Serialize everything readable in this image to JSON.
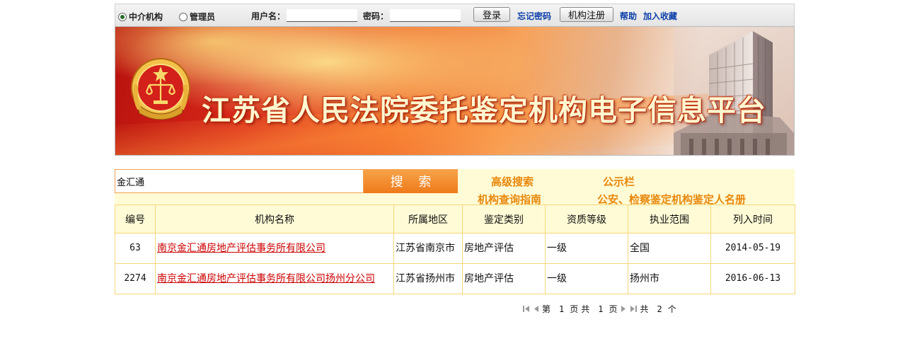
{
  "login": {
    "role_options": [
      {
        "label": "中介机构",
        "checked": true
      },
      {
        "label": "管理员",
        "checked": false
      }
    ],
    "username_label": "用户名：",
    "username_value": "",
    "password_label": "密码：",
    "password_value": "",
    "login_button": "登录",
    "forgot_link": "忘记密码",
    "register_button": "机构注册",
    "help_link": "帮助",
    "favorite_link": "加入收藏"
  },
  "banner": {
    "title": "江苏省人民法院委托鉴定机构电子信息平台",
    "emblem_icon": "court-emblem-icon",
    "building_icon": "court-building-icon"
  },
  "search": {
    "value": "金汇通",
    "button": "搜 索",
    "links": {
      "advanced": "高级搜索",
      "notice": "公示栏",
      "guide": "机构查询指南",
      "registry": "公安、检察鉴定机构鉴定人名册"
    }
  },
  "table": {
    "headers": [
      "编号",
      "机构名称",
      "所属地区",
      "鉴定类别",
      "资质等级",
      "执业范围",
      "列入时间"
    ],
    "rows": [
      {
        "id": "63",
        "name": "南京金汇通房地产评估事务所有限公司",
        "region": "江苏省南京市",
        "category": "房地产评估",
        "level": "一级",
        "scope": "全国",
        "date": "2014-05-19"
      },
      {
        "id": "2274",
        "name": "南京金汇通房地产评估事务所有限公司扬州分公司",
        "region": "江苏省扬州市",
        "category": "房地产评估",
        "level": "一级",
        "scope": "扬州市",
        "date": "2016-06-13"
      }
    ]
  },
  "pager": {
    "page_prefix": "第",
    "current_page": "1",
    "page_suffix": "页",
    "total_prefix": "共",
    "total_pages": "1",
    "total_pages_suffix": "页",
    "count_prefix": "共",
    "total_count": "2",
    "count_suffix": "个"
  },
  "colors": {
    "link_blue": "#0b3ea8",
    "accent_orange": "#ee7a1a",
    "search_link_orange": "#e8880c",
    "table_border": "#f6d77a",
    "header_bg": "#fffbd6",
    "result_link": "#cc0000"
  }
}
